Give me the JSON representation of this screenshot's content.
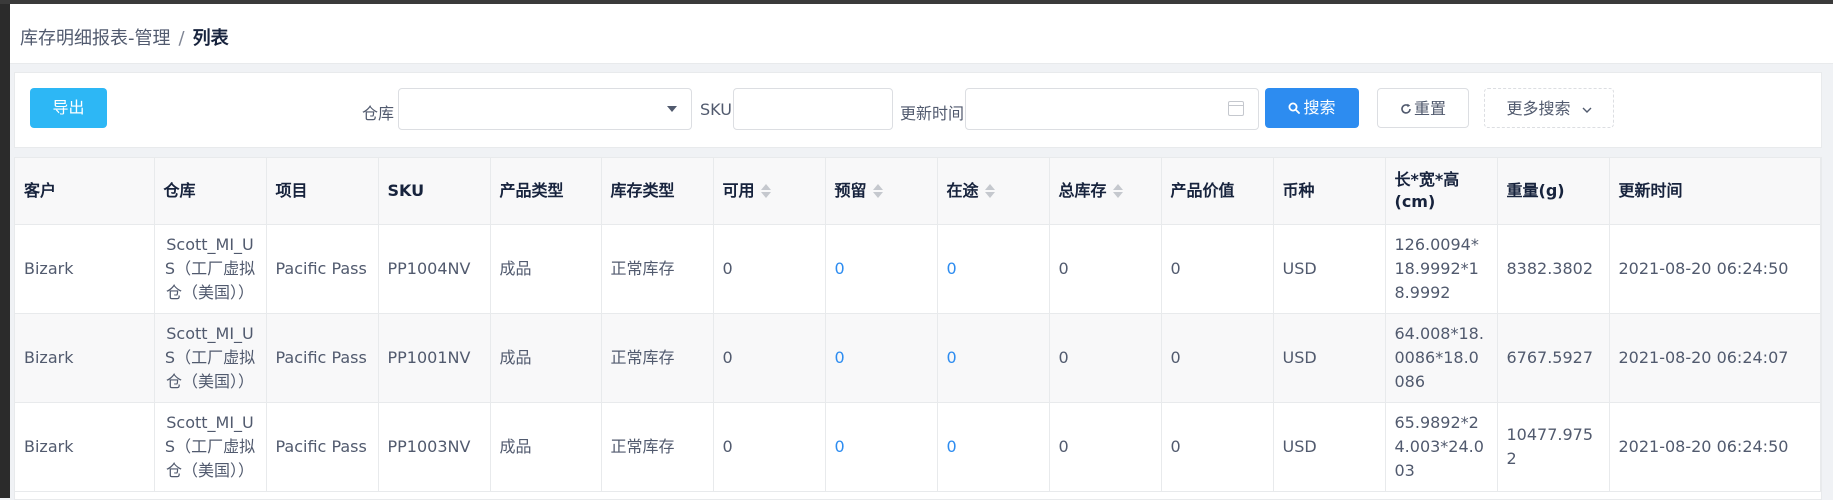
{
  "breadcrumb": {
    "parent": "库存明细报表-管理",
    "separator": "/",
    "current": "列表"
  },
  "toolbar": {
    "export_label": "导出",
    "warehouse_label": "仓库",
    "warehouse_value": "",
    "sku_label": "SKU",
    "sku_value": "",
    "update_time_label": "更新时间",
    "update_time_value": "",
    "search_label": "搜索",
    "reset_label": "重置",
    "more_search_label": "更多搜索"
  },
  "table": {
    "headers": {
      "customer": "客户",
      "warehouse": "仓库",
      "project": "项目",
      "sku": "SKU",
      "product_type": "产品类型",
      "stock_type": "库存类型",
      "available": "可用",
      "reserved": "预留",
      "in_transit": "在途",
      "total_stock": "总库存",
      "product_value": "产品价值",
      "currency": "币种",
      "dimensions": "长*宽*高(cm)",
      "weight": "重量(g)",
      "update_time": "更新时间"
    },
    "rows": [
      {
        "customer": "Bizark",
        "warehouse": "Scott_MI_US（工厂虚拟仓（美国））",
        "project": "Pacific Pass",
        "sku": "PP1004NV",
        "product_type": "成品",
        "stock_type": "正常库存",
        "available": "0",
        "reserved": "0",
        "in_transit": "0",
        "total_stock": "0",
        "product_value": "0",
        "currency": "USD",
        "dimensions": "126.0094*18.9992*18.9992",
        "weight": "8382.3802",
        "update_time": "2021-08-20 06:24:50"
      },
      {
        "customer": "Bizark",
        "warehouse": "Scott_MI_US（工厂虚拟仓（美国））",
        "project": "Pacific Pass",
        "sku": "PP1001NV",
        "product_type": "成品",
        "stock_type": "正常库存",
        "available": "0",
        "reserved": "0",
        "in_transit": "0",
        "total_stock": "0",
        "product_value": "0",
        "currency": "USD",
        "dimensions": "64.008*18.0086*18.0086",
        "weight": "6767.5927",
        "update_time": "2021-08-20 06:24:07"
      },
      {
        "customer": "Bizark",
        "warehouse": "Scott_MI_US（工厂虚拟仓（美国））",
        "project": "Pacific Pass",
        "sku": "PP1003NV",
        "product_type": "成品",
        "stock_type": "正常库存",
        "available": "0",
        "reserved": "0",
        "in_transit": "0",
        "total_stock": "0",
        "product_value": "0",
        "currency": "USD",
        "dimensions": "65.9892*24.003*24.003",
        "weight": "10477.9752",
        "update_time": "2021-08-20 06:24:50"
      }
    ]
  },
  "icons": {
    "search": "search-icon",
    "reset": "refresh-icon",
    "more": "chevron-down-icon",
    "calendar": "calendar-icon",
    "dropdown": "caret-down-icon",
    "sort": "sort-icon"
  },
  "colors": {
    "primary": "#2d8cf0",
    "info": "#2db7f5",
    "header_bg": "#f8f8f9",
    "border": "#e8eaec"
  }
}
